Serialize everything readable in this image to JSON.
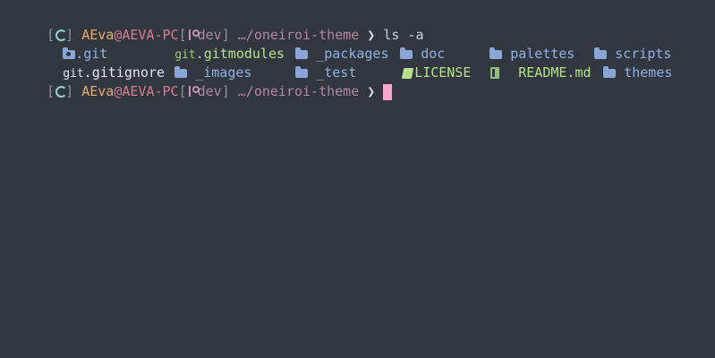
{
  "prompt": {
    "open_bracket": "[",
    "close_bracket_user": "]",
    "user": "AEva",
    "at": "@",
    "host": "AEVA-PC",
    "branch_open": "[",
    "branch": "dev",
    "branch_close": "]",
    "path": "…/oneiroi-theme",
    "arrow": "❯",
    "debian_icon": "debian-icon",
    "branch_icon": "git-branch-icon"
  },
  "commands": [
    {
      "text": "ls -a"
    },
    {
      "text": ""
    }
  ],
  "listing": {
    "row1": [
      {
        "name": ".git",
        "kind": "git-folder",
        "icon": "git-folder-icon"
      },
      {
        "name": ".gitmodules",
        "kind": "git-file",
        "icon_text": "git",
        "icon": "git-icon"
      },
      {
        "name": "_packages",
        "kind": "folder",
        "icon": "folder-icon"
      },
      {
        "name": "doc",
        "kind": "folder",
        "icon": "folder-icon"
      },
      {
        "name": "palettes",
        "kind": "folder",
        "icon": "folder-icon"
      },
      {
        "name": "scripts",
        "kind": "folder",
        "icon": "folder-icon"
      }
    ],
    "row2": [
      {
        "name": ".gitignore",
        "kind": "git-file",
        "icon_text": "git",
        "icon": "git-icon"
      },
      {
        "name": "_images",
        "kind": "folder",
        "icon": "folder-icon"
      },
      {
        "name": "_test",
        "kind": "folder",
        "icon": "folder-icon"
      },
      {
        "name": "LICENSE",
        "kind": "license",
        "icon": "license-book-icon"
      },
      {
        "name": "README.md",
        "kind": "markdown",
        "icon": "markdown-icon"
      },
      {
        "name": "themes",
        "kind": "folder",
        "icon": "folder-icon"
      }
    ]
  },
  "colors": {
    "background": "#31363f",
    "user": "#e4ac74",
    "host": "#d77e90",
    "path": "#b3889f",
    "folder": "#8aa6d8",
    "git": "#b7e08c",
    "cursor": "#f7a6c8"
  }
}
